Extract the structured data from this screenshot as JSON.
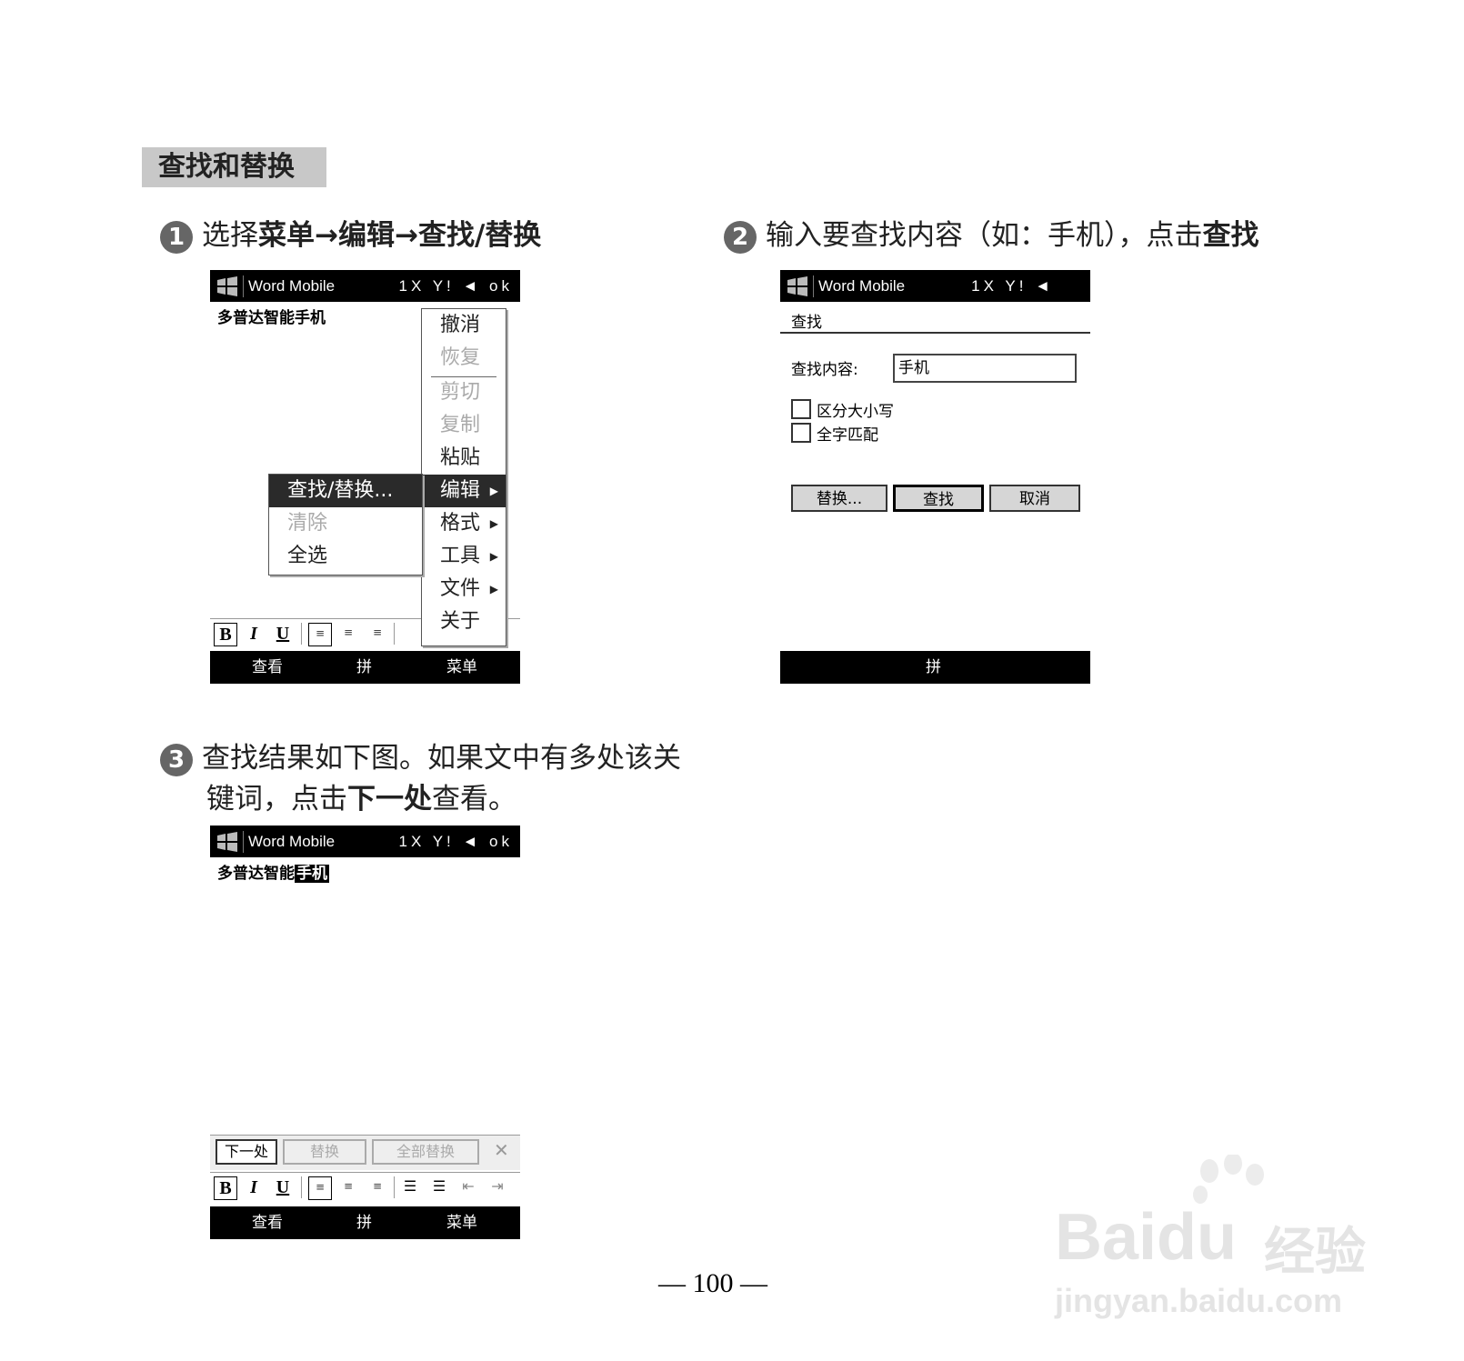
{
  "section_title": "查找和替换",
  "steps": [
    {
      "num": "1",
      "pre": "选择",
      "b1": "菜单",
      "arrow1": "→",
      "b2": "编辑",
      "arrow2": "→",
      "b3": "查找/替换"
    },
    {
      "num": "2",
      "pre": "输入要查找内容（如：手机），点击",
      "b1": "查找"
    },
    {
      "num": "3",
      "line1": "查找结果如下图。如果文中有多处该关",
      "line2_pre": "键词，点击",
      "line2_b": "下一处",
      "line2_post": "查看。"
    }
  ],
  "app_title": "Word Mobile",
  "status_icons": "1X Y! ◄ ok",
  "status_icons_dialog": "1X Y! ◄",
  "doc_text": "多普达智能手机",
  "doc_text_plain": "多普达智能",
  "doc_text_match": "手机",
  "menu": {
    "items": [
      {
        "label": "撤消",
        "disabled": false
      },
      {
        "label": "恢复",
        "disabled": true
      },
      {
        "label": "剪切",
        "disabled": true
      },
      {
        "label": "复制",
        "disabled": true
      },
      {
        "label": "粘贴",
        "disabled": false
      },
      {
        "label": "编辑",
        "disabled": false,
        "submenu": true,
        "selected": true
      },
      {
        "label": "格式",
        "disabled": false,
        "submenu": true
      },
      {
        "label": "工具",
        "disabled": false,
        "submenu": true
      },
      {
        "label": "文件",
        "disabled": false,
        "submenu": true
      },
      {
        "label": "关于",
        "disabled": false
      }
    ],
    "submenu": [
      {
        "label": "查找/替换...",
        "selected": true
      },
      {
        "label": "清除",
        "disabled": true
      },
      {
        "label": "全选"
      }
    ]
  },
  "softkeys": {
    "left": "查看",
    "middle": "拼",
    "right": "菜单"
  },
  "format_bar": {
    "bold": "B",
    "italic": "I",
    "underline": "U"
  },
  "find_dialog": {
    "header": "查找",
    "find_label": "查找内容:",
    "find_value": "手机",
    "match_case": "区分大小写",
    "whole_word": "全字匹配",
    "btn_replace": "替换...",
    "btn_find": "查找",
    "btn_cancel": "取消",
    "softkey_middle": "拼"
  },
  "find_toolbar": {
    "next": "下一处",
    "replace": "替换",
    "replace_all": "全部替换",
    "close": "✕"
  },
  "page_number": "— 100 —",
  "watermark": {
    "brand": "Bai",
    "brand2": "du",
    "cn": "经验",
    "url": "jingyan.baidu.com"
  }
}
